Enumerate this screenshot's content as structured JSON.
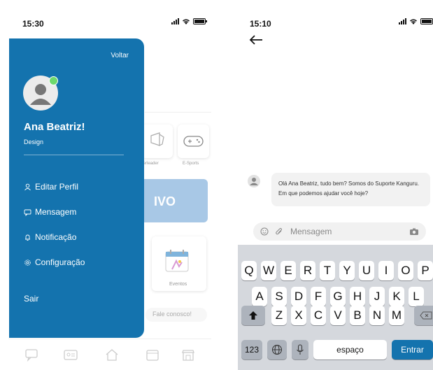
{
  "left_screen": {
    "time": "15:30",
    "drawer": {
      "back_label": "Voltar",
      "user_name": "Ana Beatriz!",
      "user_role": "Design",
      "menu": [
        {
          "label": "Editar Perfil",
          "icon": "user-icon"
        },
        {
          "label": "Mensagem",
          "icon": "message-icon"
        },
        {
          "label": "Notificação",
          "icon": "bell-icon"
        },
        {
          "label": "Configuração",
          "icon": "gear-icon"
        }
      ],
      "logout_label": "Sair"
    },
    "background": {
      "card1_caption": "heerleader",
      "card2_caption": "E-Sports",
      "banner_text": "IVO",
      "events_caption": "Eventos",
      "chat_prompt": "Fale conosco!"
    },
    "colors": {
      "drawer": "#1473ae",
      "online": "#6dd96d"
    }
  },
  "right_screen": {
    "time": "15:10",
    "message": "Olá Ana Beatriz, tudo bem? Somos do Suporte Kanguru. Em que podemos ajudar você hoje?",
    "input_placeholder": "Mensagem",
    "keyboard": {
      "row1": [
        "Q",
        "W",
        "E",
        "R",
        "T",
        "Y",
        "U",
        "I",
        "O",
        "P"
      ],
      "row2": [
        "A",
        "S",
        "D",
        "F",
        "G",
        "H",
        "J",
        "K",
        "L"
      ],
      "row3": [
        "Z",
        "X",
        "C",
        "V",
        "B",
        "N",
        "M"
      ],
      "numbers_key": "123",
      "space_key": "espaço",
      "enter_key": "Entrar"
    }
  }
}
